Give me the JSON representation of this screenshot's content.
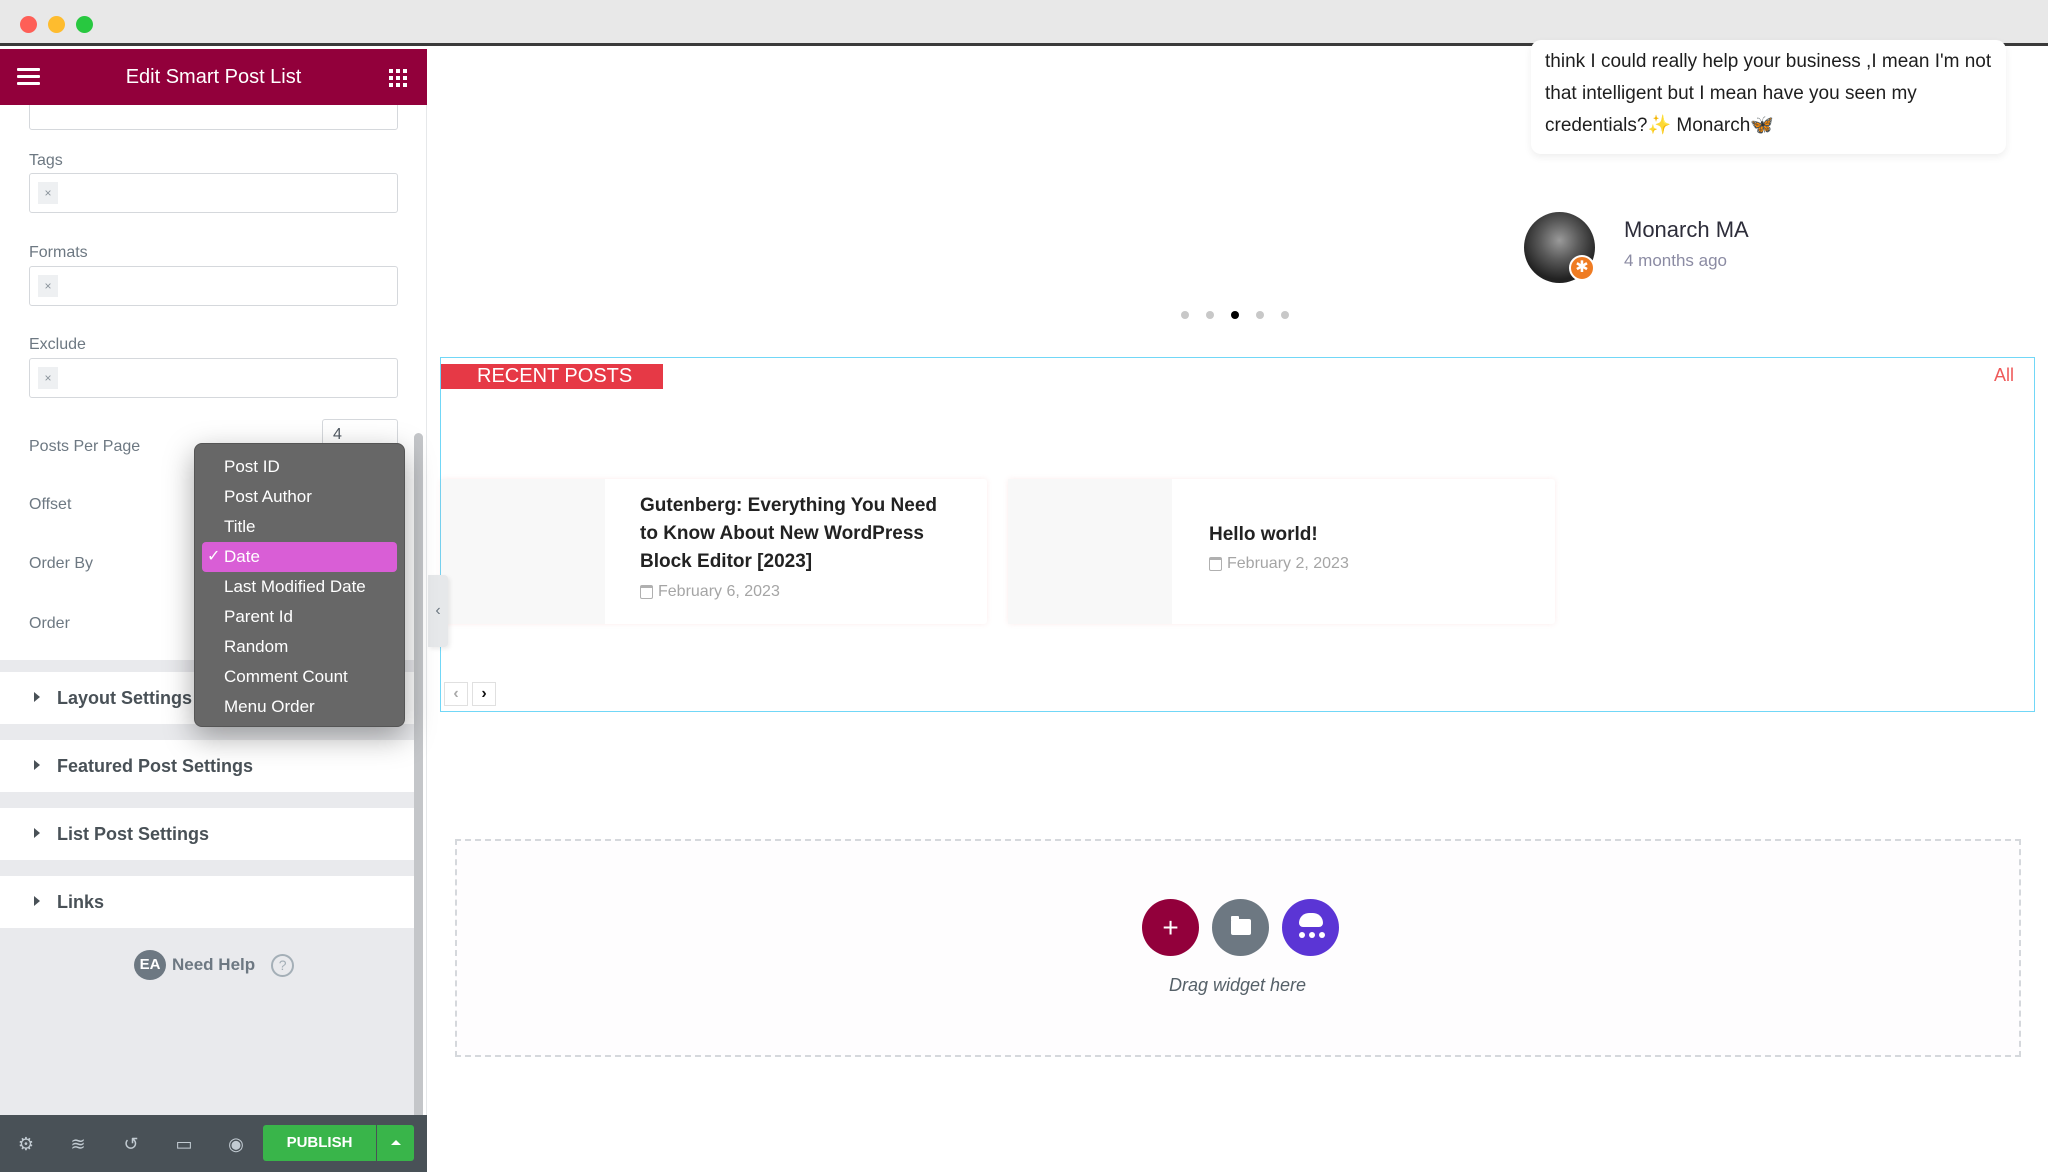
{
  "window": {
    "controls": [
      "close",
      "minimize",
      "maximize"
    ]
  },
  "sidebar": {
    "header": {
      "title": "Edit Smart Post List",
      "menu_icon": "hamburger-icon",
      "widgets_icon": "grid-icon"
    },
    "fields": {
      "tags": {
        "label": "Tags",
        "chip": "×"
      },
      "formats": {
        "label": "Formats",
        "chip": "×"
      },
      "exclude": {
        "label": "Exclude",
        "chip": "×"
      },
      "posts_per_page": {
        "label": "Posts Per Page",
        "value": "4"
      },
      "offset": {
        "label": "Offset"
      },
      "order_by": {
        "label": "Order By"
      },
      "order": {
        "label": "Order"
      }
    },
    "order_by_dropdown": {
      "selected": "Date",
      "check": "✓",
      "options": [
        "Post ID",
        "Post Author",
        "Title",
        "Date",
        "Last Modified Date",
        "Parent Id",
        "Random",
        "Comment Count",
        "Menu Order"
      ]
    },
    "sections": [
      {
        "label": "Layout Settings"
      },
      {
        "label": "Featured Post Settings"
      },
      {
        "label": "List Post Settings"
      },
      {
        "label": "Links"
      }
    ],
    "help": {
      "logo": "EA",
      "text": "Need Help",
      "icon": "?"
    },
    "footer": {
      "icons": [
        "settings-icon",
        "layers-icon",
        "history-icon",
        "responsive-icon",
        "preview-icon"
      ],
      "publish_label": "PUBLISH"
    }
  },
  "canvas": {
    "testimonial": {
      "text": "think I could really help your business ,I mean I'm not that intelligent but I mean have you seen my credentials?✨ Monarch🦋",
      "author": "Monarch MA",
      "time": "4 months ago",
      "slides": 5,
      "active_slide": 3
    },
    "recent_posts": {
      "title": "RECENT POSTS",
      "all_link": "All",
      "posts": [
        {
          "title": "Gutenberg: Everything You Need to Know About New WordPress Block Editor [2023]",
          "date": "February 6, 2023"
        },
        {
          "title": "Hello world!",
          "date": "February 2, 2023"
        }
      ],
      "prev_label": "‹",
      "next_label": "›"
    },
    "drop_zone": {
      "text": "Drag widget here",
      "add_label": "+"
    }
  },
  "colors": {
    "brand": "#92003b",
    "publish": "#39b54a",
    "highlight": "#d95ed6",
    "recent_posts_accent": "#e63946",
    "widget_border": "#71d7f7"
  }
}
